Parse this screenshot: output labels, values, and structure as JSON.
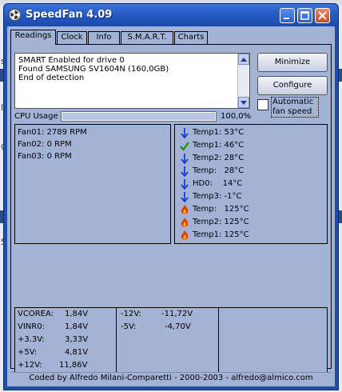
{
  "window": {
    "title": "SpeedFan 4.09"
  },
  "background": {
    "letter1": "s",
    "letter2": "lo",
    "letter3": "S",
    "letter4": "g"
  },
  "tabs": [
    {
      "label": "Readings"
    },
    {
      "label": "Clock"
    },
    {
      "label": "Info"
    },
    {
      "label": "S.M.A.R.T."
    },
    {
      "label": "Charts"
    }
  ],
  "log": {
    "lines": [
      "SMART Enabled for drive 0",
      "Found SAMSUNG SV1604N (160,0GB)",
      "End of detection"
    ]
  },
  "buttons": {
    "minimize": "Minimize",
    "configure": "Configure"
  },
  "auto_fan": {
    "label": "Automatic fan speed",
    "checked": false
  },
  "cpu": {
    "label": "CPU Usage",
    "value_text": "100,0%",
    "value": 1.0
  },
  "fans": [
    "Fan01: 2789 RPM",
    "Fan02: 0 RPM",
    "Fan03: 0 RPM"
  ],
  "temps": [
    {
      "icon": "arrow-down-icon",
      "text": "Temp1: 53°C"
    },
    {
      "icon": "checkmark-icon",
      "text": "Temp1: 46°C"
    },
    {
      "icon": "arrow-down-icon",
      "text": "Temp2: 28°C"
    },
    {
      "icon": "arrow-down-icon",
      "text": "Temp:   28°C"
    },
    {
      "icon": "arrow-down-icon",
      "text": "HD0:    14°C"
    },
    {
      "icon": "arrow-down-icon",
      "text": "Temp3: -1°C"
    },
    {
      "icon": "flame-icon",
      "text": "Temp:   125°C"
    },
    {
      "icon": "flame-icon",
      "text": "Temp2: 125°C"
    },
    {
      "icon": "flame-icon",
      "text": "Temp1: 125°C"
    }
  ],
  "voltages": {
    "col1": [
      {
        "name": "VCOREA:",
        "value": "1,84V"
      },
      {
        "name": "VINR0:",
        "value": "1,84V"
      },
      {
        "name": "+3.3V:",
        "value": "3,33V"
      },
      {
        "name": "+5V:",
        "value": "4,81V"
      },
      {
        "name": "+12V:",
        "value": "11,86V"
      }
    ],
    "col2": [
      {
        "name": "-12V:",
        "value": "-11,72V"
      },
      {
        "name": "-5V:",
        "value": "-4,70V"
      }
    ]
  },
  "footer": "Coded by Alfredo Milani-Comparetti - 2000-2003 - alfredo@almico.com",
  "colors": {
    "arrow": "#0033cc",
    "check": "#1a8a1a",
    "flame": "#e23a00",
    "titlebar": "#2457c0",
    "client": "#a3b3d6"
  }
}
